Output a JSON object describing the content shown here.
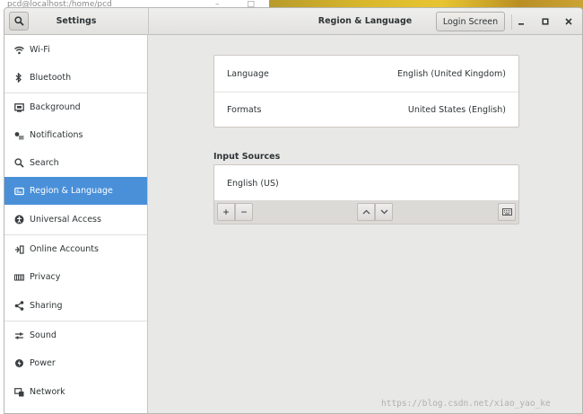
{
  "background": {
    "terminal_title": "pcd@localhost:/home/pcd",
    "watermark": "https://blog.csdn.net/xiao_yao_ke"
  },
  "titlebar": {
    "sidebar_title": "Settings",
    "page_title": "Region & Language",
    "login_screen_label": "Login Screen"
  },
  "sidebar": {
    "items": [
      {
        "label": "Wi-Fi",
        "icon": "wifi-icon"
      },
      {
        "label": "Bluetooth",
        "icon": "bluetooth-icon"
      },
      {
        "label": "Background",
        "icon": "background-icon"
      },
      {
        "label": "Notifications",
        "icon": "notifications-icon"
      },
      {
        "label": "Search",
        "icon": "search-icon"
      },
      {
        "label": "Region & Language",
        "icon": "region-icon",
        "active": true
      },
      {
        "label": "Universal Access",
        "icon": "universal-access-icon"
      },
      {
        "label": "Online Accounts",
        "icon": "online-accounts-icon"
      },
      {
        "label": "Privacy",
        "icon": "privacy-icon"
      },
      {
        "label": "Sharing",
        "icon": "sharing-icon"
      },
      {
        "label": "Sound",
        "icon": "sound-icon"
      },
      {
        "label": "Power",
        "icon": "power-icon"
      },
      {
        "label": "Network",
        "icon": "network-icon"
      }
    ]
  },
  "main": {
    "language_label": "Language",
    "language_value": "English (United Kingdom)",
    "formats_label": "Formats",
    "formats_value": "United States (English)",
    "input_sources_title": "Input Sources",
    "input_sources": [
      "English (US)"
    ],
    "add_label": "+",
    "remove_label": "−"
  },
  "colors": {
    "accent": "#4a90d9",
    "window_bg": "#e8e8e7"
  }
}
